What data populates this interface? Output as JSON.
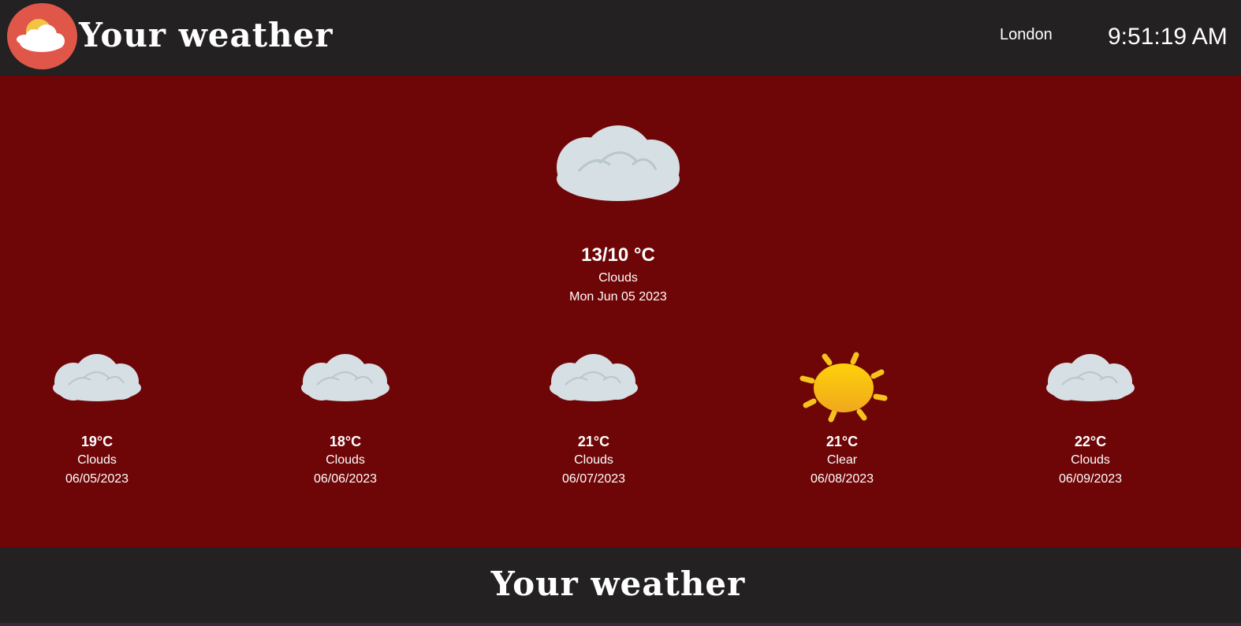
{
  "header": {
    "logo_icon": "partly-cloudy-icon",
    "title": "Your weather",
    "city": "London",
    "time": "9:51:19 AM"
  },
  "current": {
    "icon": "cloud-icon",
    "temperature": "13/10 °C",
    "condition": "Clouds",
    "date": "Mon Jun 05 2023"
  },
  "forecast": [
    {
      "icon": "cloud-icon",
      "temperature": "19°C",
      "condition": "Clouds",
      "date": "06/05/2023"
    },
    {
      "icon": "cloud-icon",
      "temperature": "18°C",
      "condition": "Clouds",
      "date": "06/06/2023"
    },
    {
      "icon": "cloud-icon",
      "temperature": "21°C",
      "condition": "Clouds",
      "date": "06/07/2023"
    },
    {
      "icon": "sun-icon",
      "temperature": "21°C",
      "condition": "Clear",
      "date": "06/08/2023"
    },
    {
      "icon": "cloud-icon",
      "temperature": "22°C",
      "condition": "Clouds",
      "date": "06/09/2023"
    }
  ],
  "footer": {
    "title": "Your weather"
  },
  "colors": {
    "header_bg": "#232121",
    "main_bg": "#6e0506",
    "logo_bg": "#e0574a",
    "cloud": "#d5dfe4",
    "sun": "#f6c21c"
  }
}
